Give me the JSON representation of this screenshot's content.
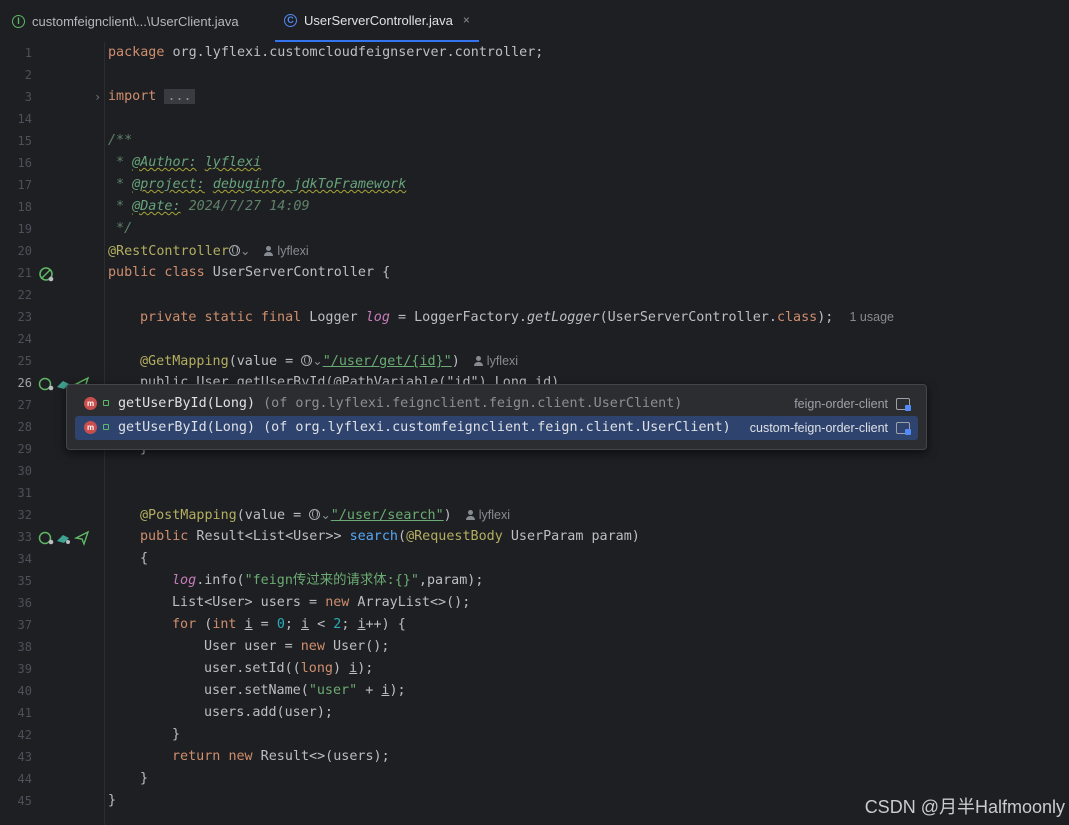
{
  "tabs": [
    {
      "label": "customfeignclient\\...\\UserClient.java",
      "icon": "interface-icon",
      "active": false
    },
    {
      "label": "UserServerController.java",
      "icon": "class-icon",
      "active": true,
      "close": "×"
    }
  ],
  "lines": {
    "l1": "1",
    "l2": "2",
    "l3": "3",
    "l14": "14",
    "l15": "15",
    "l16": "16",
    "l17": "17",
    "l18": "18",
    "l19": "19",
    "l20": "20",
    "l21": "21",
    "l22": "22",
    "l23": "23",
    "l24": "24",
    "l25": "25",
    "l26": "26",
    "l27": "27",
    "l28": "28",
    "l29": "29",
    "l30": "30",
    "l31": "31",
    "l32": "32",
    "l33": "33",
    "l34": "34",
    "l35": "35",
    "l36": "36",
    "l37": "37",
    "l38": "38",
    "l39": "39",
    "l40": "40",
    "l41": "41",
    "l42": "42",
    "l43": "43",
    "l44": "44",
    "l45": "45"
  },
  "code": {
    "package_kw": "package",
    "package_name": " org.lyflexi.customcloudfeignserver.controller;",
    "import_kw": "import",
    "import_fold": "...",
    "doc_open": "/**",
    "doc_star": " * ",
    "author_tag": "@Author:",
    "author_val": "lyflexi",
    "project_tag": "@project:",
    "project_val": "debuginfo_jdkToFramework",
    "date_tag": "@Date:",
    "date_val": " 2024/7/27 14:09",
    "doc_close": " */",
    "rest_controller": "@RestController",
    "author_hint": "lyflexi",
    "class_decl_kw": "public class",
    "class_name": " UserServerController {",
    "logger_kw": "private static final",
    "logger_type": " Logger ",
    "logger_var": "log",
    "logger_eq": " = LoggerFactory.",
    "logger_method": "getLogger",
    "logger_arg": "(UserServerController.",
    "class_kw": "class",
    "logger_end": ");",
    "usage_hint": "1 usage",
    "get_mapping": "@GetMapping",
    "value_eq": "(value = ",
    "get_path": "\"/user/get/{id}\"",
    "paren_close": ")",
    "line26_text": "public User getUserById(@PathVariable(\"id\") Long id)",
    "line29_text": "}",
    "post_mapping": "@PostMapping",
    "post_path": "\"/user/search\"",
    "line33_kw": "public",
    "line33_type": " Result<List<User>> ",
    "line33_method": "search",
    "line33_paren": "(",
    "request_body": "@RequestBody",
    "line33_rest": " UserParam param)",
    "line34": "{",
    "line35_var": "log",
    "line35_call": ".info(",
    "line35_str": "\"feign传过来的请求体:{}\"",
    "line35_end": ",param);",
    "line36_a": "List<User> users = ",
    "new_kw": "new",
    "line36_b": " ArrayList<>();",
    "for_kw": "for",
    "int_kw": "int",
    "var_i": "i",
    "zero": "0",
    "two": "2",
    "line38_a": "User user = ",
    "line38_b": " User();",
    "line39_a": "user.setId((",
    "long_kw": "long",
    "line39_b": ") ",
    "line39_c": ");",
    "line40_a": "user.setName(",
    "line40_str": "\"user\"",
    "line40_b": " + ",
    "line40_c": ");",
    "line41": "users.add(user);",
    "line42": "}",
    "return_kw": "return",
    "line43_b": " Result<>(users);",
    "line44": "}",
    "line45": "}"
  },
  "popup": {
    "items": [
      {
        "method": "getUserById(Long)",
        "detail": " (of org.lyflexi.feignclient.feign.client.UserClient)",
        "module": "feign-order-client",
        "selected": false
      },
      {
        "method": "getUserById(Long)",
        "detail": " (of org.lyflexi.customfeignclient.feign.client.UserClient)",
        "module": "custom-feign-order-client",
        "selected": true
      }
    ],
    "icon_letter": "m"
  },
  "watermark": "CSDN @月半Halfmoonly"
}
